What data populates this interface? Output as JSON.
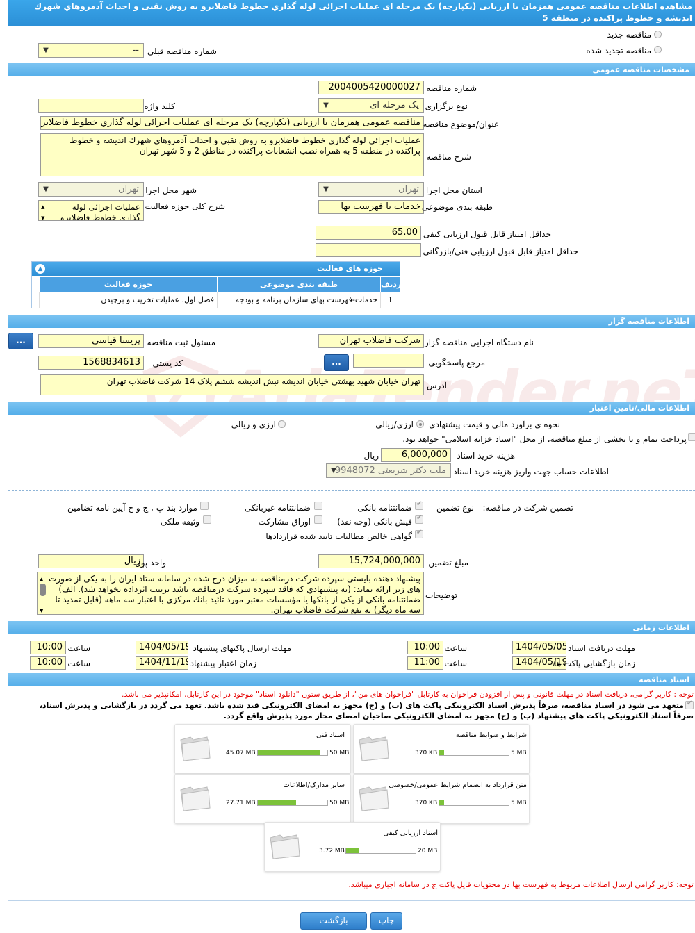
{
  "page_title": "مشاهده اطلاعات مناقصه عمومی همزمان با ارزیابی (یکپارچه) یک مرحله ای عملیات اجرائی لوله گذاري خطوط فاضلابرو به روش نقبی و احداث آدمروهاي شهرك اندیشه و خطوط پراکنده در منطقه 5",
  "top": {
    "radio_new": "مناقصه جدید",
    "radio_renewed": "مناقصه تجدید شده",
    "prev_number_label": "شماره مناقصه قبلی",
    "prev_number_value": "--"
  },
  "general": {
    "section": "مشخصات مناقصه عمومی",
    "number_label": "شماره مناقصه",
    "number_value": "2004005420000027",
    "keyword_label": "کلید واژه",
    "keyword_value": "",
    "type_label": "نوع برگزاری",
    "type_value": "یک مرحله ای",
    "subject_label": "عنوان/موضوع مناقصه",
    "subject_value": "مناقصه عمومی همزمان با ارزیابی (یکپارچه) یک مرحله ای عملیات اجرائی لوله گذاري خطوط فاضلابرو",
    "desc_label": "شرح مناقصه",
    "desc_value": "عملیات اجرائی لوله گذاري خطوط فاضلابرو به روش نقبی و احداث آدمروهاي شهرك اندیشه و خطوط پراکنده در منطقه 5 به همراه نصب انشعابات پراکنده در مناطق 2 و 5 شهر تهران",
    "province_label": "استان محل اجرا",
    "province_value": "تهران",
    "city_label": "شهر محل اجرا",
    "city_value": "تهران",
    "category_label": "طبقه بندی موضوعی",
    "category_value": "خدمات با فهرست بها",
    "scope_label": "شرح کلی حوزه فعالیت",
    "scope_value": "عملیات اجرائی لوله گذاري خطوط فاضلابرو به روش",
    "min_quality_label": "حداقل امتیاز قابل قبول ارزیابی کیفی",
    "min_quality_value": "65.00",
    "min_tech_label": "حداقل امتیاز قابل قبول ارزیابی فنی/بازرگانی",
    "min_tech_value": ""
  },
  "activity": {
    "title": "حوزه های فعالیت",
    "col_row": "ردیف",
    "col_category": "طبقه بندی موضوعی",
    "col_scope": "حوزه فعالیت",
    "rows": [
      {
        "row": "1",
        "category": "خدمات-فهرست بهای سازمان برنامه و بودجه",
        "scope": "فصل اول. عملیات تخریب و برچیدن"
      }
    ]
  },
  "organizer": {
    "section": "اطلاعات مناقصه گزار",
    "org_label": "نام دستگاه اجرایی مناقصه گزار",
    "org_value": "شرکت فاضلاب تهران",
    "registrar_label": "مسئول ثبت مناقصه",
    "registrar_value": "پریسا قیاسی",
    "ref_label": "مرجع پاسخگویی",
    "ref_value": "",
    "postal_label": "کد پستی",
    "postal_value": "1568834613",
    "address_label": "آدرس",
    "address_value": "تهران خیابان شهید بهشتی خیابان اندیشه نبش اندیشه ششم پلاک 14 شرکت فاضلاب تهران",
    "dots": "..."
  },
  "finance": {
    "section": "اطلاعات مالی/تامین اعتبار",
    "estimate_label": "نحوه ی برآورد مالی و قیمت پیشنهادی",
    "opt_currency_rial": "ارزی/ریالی",
    "opt_currency_and_rial": "ارزی و ریالی",
    "payment_text": "پرداخت تمام و یا بخشی از مبلغ مناقصه، از محل \"اسناد خزانه اسلامی\" خواهد بود.",
    "doc_cost_label": "هزینه خرید اسناد",
    "doc_cost_value": "6,000,000",
    "doc_cost_unit": "ریال",
    "account_label": "اطلاعات حساب جهت واریز هزینه خرید اسناد",
    "account_value": "ملت دکتر شریعتی 9948072"
  },
  "guarantee": {
    "label": "تضمین شرکت در مناقصه:",
    "type_label": "نوع تضمین",
    "options": {
      "bank_guarantee": "ضمانتنامه بانکی",
      "non_bank_guarantee": "ضمانتنامه غیربانکی",
      "clauses": "موارد بند پ ، ج و خ آیین نامه تضامین",
      "bank_receipt": "فیش بانکی (وجه نقد)",
      "bonds": "اوراق مشارکت",
      "property": "وثیقه ملکی",
      "net_claims": "گواهی خالص مطالبات تایید شده قراردادها"
    },
    "amount_label": "مبلغ تضمین",
    "amount_value": "15,724,000,000",
    "currency_label": "واحد پول",
    "currency_value": "ریال",
    "notes_label": "توضیحات",
    "notes_value": "پیشنهاد دهنده بایستی سپرده شرکت درمناقصه به میزان درج شده در سامانه ستاد ایران  را به یکی از صورت های زیر ارائه نماید: (به پیشنهادي که فاقد سپرده شرکت درمناقصه باشد ترتیب اثرداده نخواهد شد). الف) ضمانتنامه بانکی از یکی از بانکها یا مؤسسات معتبر مورد تائید بانك مرکزي با اعتبار سه ماهه (قابل تمدید تا سه ماه دیگر) به نفع شرکت فاضلاب تهران."
  },
  "timing": {
    "section": "اطلاعات زمانی",
    "receive_docs_label": "مهلت دریافت اسناد",
    "receive_docs_date": "1404/05/05",
    "receive_docs_time": "10:00",
    "send_label": "مهلت ارسال پاکتهای پیشنهاد",
    "send_date": "1404/05/19",
    "send_time": "10:00",
    "open_label": "زمان بازگشایی پاکت ها",
    "open_date": "1404/05/19",
    "open_time": "11:00",
    "validity_label": "زمان اعتبار پیشنهاد",
    "validity_date": "1404/11/19",
    "validity_time": "10:00",
    "time_label": "ساعت"
  },
  "documents": {
    "section": "اسناد مناقصه",
    "note1": "توجه : کاربر گرامی، دریافت اسناد در مهلت قانونی و پس از افزودن فراخوان به کارتابل \"فراخوان های من\"، از طریق ستون \"دانلود اسناد\" موجود در این کارتابل، امکانپذیر می باشد.",
    "commit_line1": "متعهد می شود در اسناد مناقصه، صرفاً پذیرش اسناد الکترونیکی پاکت های (ب) و (ج) مجهز به امضای الکترونیکی قید شده باشد. تعهد می گردد در بازگشایی و پذیرش اسناد،",
    "commit_line2": "صرفاً اسناد الکترونیکی پاکت های پیشنهاد (ب) و (ج) مجهز به امضای الکترونیکی صاحبان امضای مجاز مورد پذیرش واقع گردد.",
    "files": [
      {
        "name": "شرایط و ضوابط مناقصه",
        "size": "370 KB",
        "max": "5 MB",
        "fill": 0.07
      },
      {
        "name": "اسناد فنی",
        "size": "45.07 MB",
        "max": "50 MB",
        "fill": 0.9
      },
      {
        "name": "متن قرارداد به انضمام شرایط عمومی/خصوصی",
        "size": "370 KB",
        "max": "5 MB",
        "fill": 0.07
      },
      {
        "name": "سایر مدارک/اطلاعات",
        "size": "27.71 MB",
        "max": "50 MB",
        "fill": 0.55
      },
      {
        "name": "اسناد ارزیابی کیفی",
        "size": "3.72 MB",
        "max": "20 MB",
        "fill": 0.19
      }
    ],
    "note2": "توجه: کاربر گرامی ارسال اطلاعات مربوط به فهرست بها در محتویات فایل پاکت ج در سامانه اجباری میباشد."
  },
  "buttons": {
    "back": "بازگشت",
    "print": "چاپ"
  },
  "watermark": "AriaTender.neT"
}
